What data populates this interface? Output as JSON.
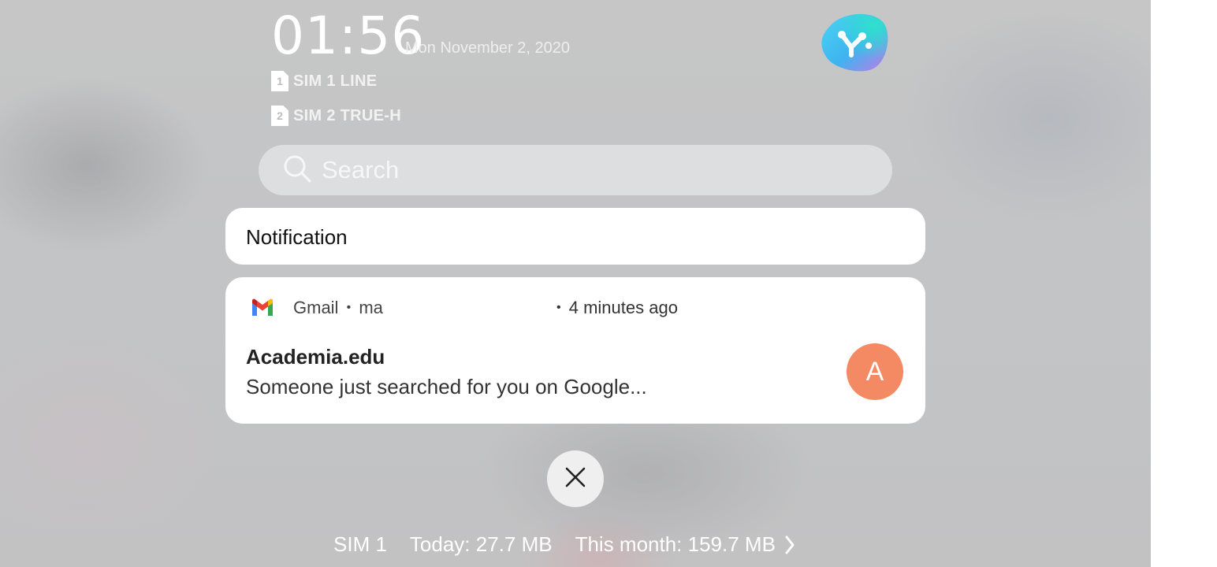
{
  "lockscreen": {
    "time": "01:56",
    "date": "Mon November 2, 2020",
    "sims": [
      {
        "slot": "1",
        "label": "SIM 1 LINE"
      },
      {
        "slot": "2",
        "label": "SIM 2 TRUE-H"
      }
    ],
    "logo_icon": "assistant-logo-icon"
  },
  "search": {
    "placeholder": "Search",
    "icon": "search-icon"
  },
  "notification_header": {
    "title": "Notification"
  },
  "notifications": [
    {
      "app_icon": "gmail-icon",
      "app_name": "Gmail",
      "separator": "•",
      "account": "ma",
      "time": "4 minutes ago",
      "sender": "Academia.edu",
      "message": "Someone just searched for you on Google...",
      "avatar_letter": "A",
      "avatar_color": "#f48a64"
    }
  ],
  "close_button": {
    "icon": "close-icon"
  },
  "data_usage": {
    "sim": "SIM 1",
    "today": "Today: 27.7 MB",
    "month": "This month: 159.7 MB",
    "icon": "chevron-right-icon"
  }
}
